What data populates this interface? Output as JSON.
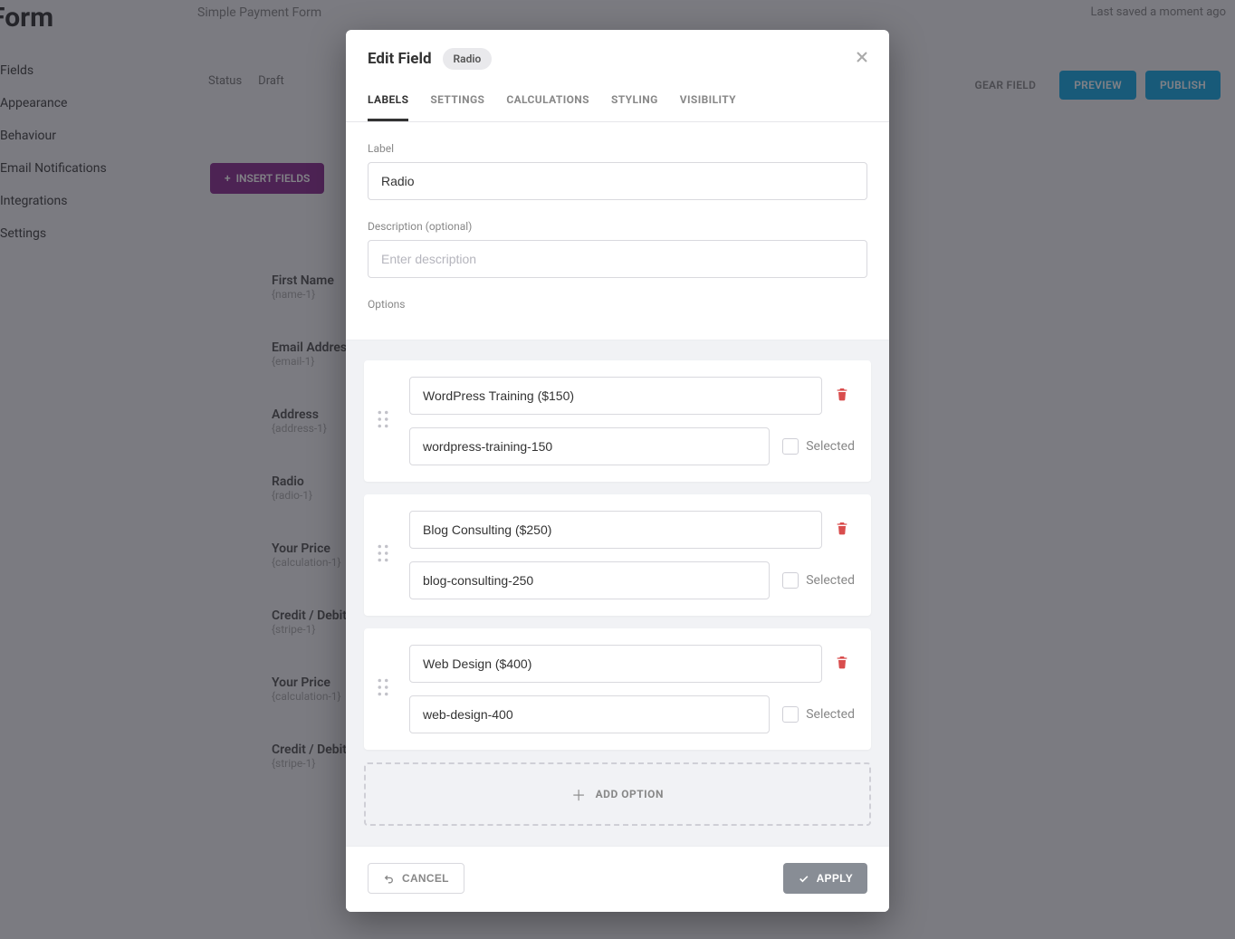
{
  "background": {
    "page_title": "Edit Form",
    "breadcrumb": "Simple Payment Form",
    "last_saved": "Last saved a moment ago",
    "sidebar_items": [
      "Fields",
      "Appearance",
      "Behaviour",
      "Email Notifications",
      "Integrations",
      "Settings"
    ],
    "status_label": "Status",
    "status_value": "Draft",
    "gearLabel": "GEAR FIELD",
    "preview": "PREVIEW",
    "publish": "PUBLISH",
    "insert_fields": "INSERT FIELDS",
    "fields": [
      {
        "title": "First Name",
        "sub": "{name-1}"
      },
      {
        "title": "Email Address",
        "sub": "{email-1}"
      },
      {
        "title": "Address",
        "sub": "{address-1}"
      },
      {
        "title": "Radio",
        "sub": "{radio-1}"
      },
      {
        "title": "Your Price",
        "sub": "{calculation-1}"
      },
      {
        "title": "Credit / Debit Card",
        "sub": "{stripe-1}"
      },
      {
        "title": "Your Price",
        "sub": "{calculation-1}"
      },
      {
        "title": "Credit / Debit Card",
        "sub": "{stripe-1}"
      }
    ]
  },
  "modal": {
    "title": "Edit Field",
    "badge": "Radio",
    "tabs": [
      "LABELS",
      "SETTINGS",
      "CALCULATIONS",
      "STYLING",
      "VISIBILITY"
    ],
    "labels": {
      "label_heading": "Label",
      "label_value": "Radio",
      "description_heading": "Description (optional)",
      "description_placeholder": "Enter description",
      "options_heading": "Options",
      "selected_text": "Selected",
      "add_option": "ADD OPTION"
    },
    "options": [
      {
        "label": "WordPress Training ($150)",
        "value": "wordpress-training-150",
        "selected": false
      },
      {
        "label": "Blog Consulting ($250)",
        "value": "blog-consulting-250",
        "selected": false
      },
      {
        "label": "Web Design ($400)",
        "value": "web-design-400",
        "selected": false
      }
    ],
    "footer": {
      "cancel": "CANCEL",
      "apply": "APPLY"
    }
  }
}
